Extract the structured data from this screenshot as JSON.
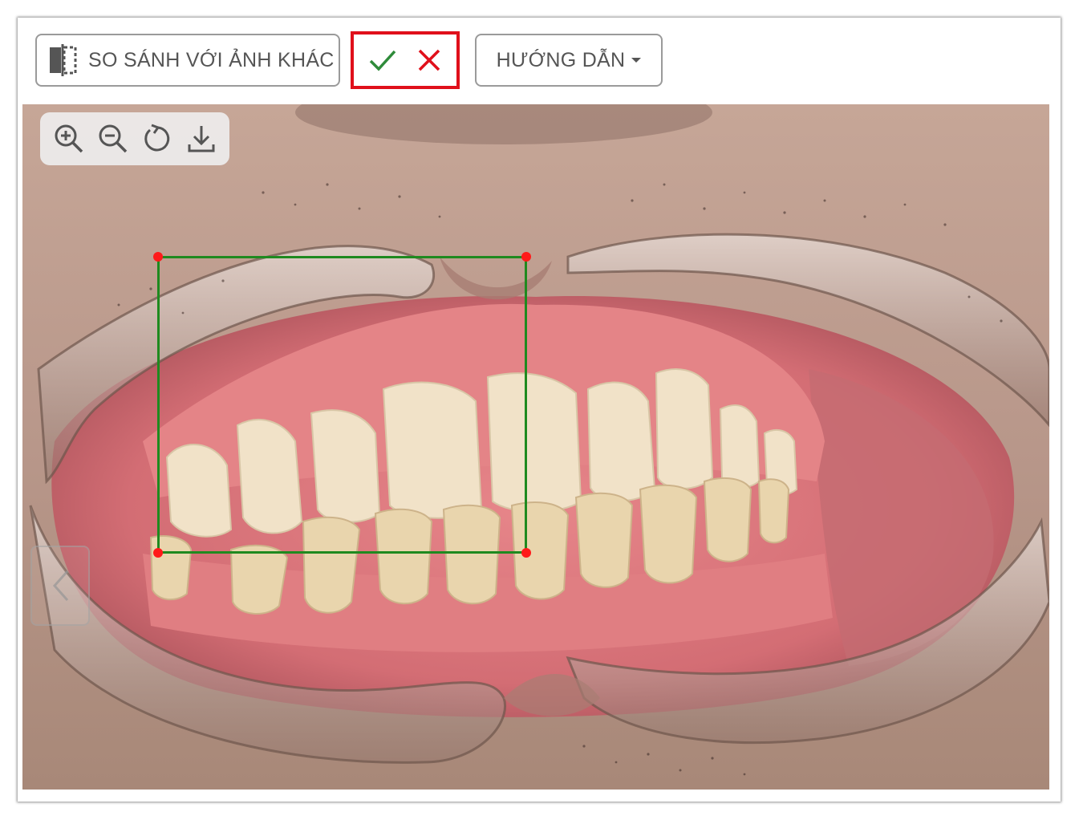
{
  "toolbar": {
    "compare_label": "SO SÁNH VỚI ẢNH KHÁC",
    "guide_label": "HƯỚNG DẪN",
    "confirm_icon": "check-icon",
    "cancel_icon": "close-icon"
  },
  "viewer": {
    "tools": [
      "zoom-in-icon",
      "zoom-out-icon",
      "rotate-icon",
      "download-icon"
    ],
    "prev_icon": "chevron-left-icon"
  },
  "colors": {
    "highlight_border": "#e0101b",
    "confirm": "#2e8b3a",
    "cancel": "#e0101b",
    "selection": "#1f8a1f",
    "handle": "#ff1a1a"
  }
}
